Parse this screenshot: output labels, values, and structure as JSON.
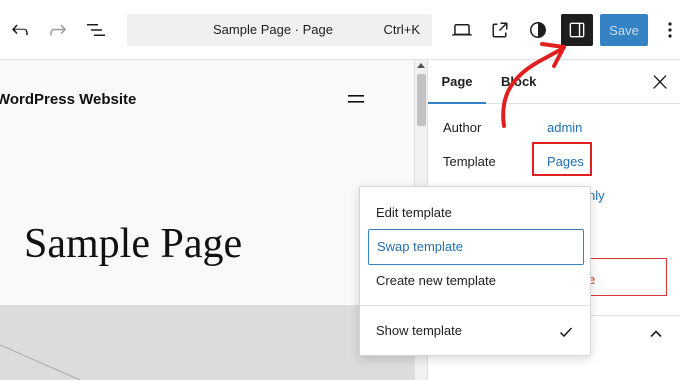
{
  "toolbar": {
    "undo_icon": "undo-icon",
    "redo_icon": "redo-icon",
    "list_view_icon": "list-view-icon",
    "document": {
      "title": "Sample Page · Page",
      "shortcut": "Ctrl+K"
    },
    "preview_icon": "desktop-preview-icon",
    "view_page_icon": "external-link-icon",
    "styles_icon": "contrast-icon",
    "settings_icon": "sidebar-panel-icon",
    "save_label": "Save",
    "more_icon": "vertical-ellipsis-icon"
  },
  "canvas": {
    "site_title": "WordPress Website",
    "page_heading": "Sample Page",
    "nav_icon": "hamburger-menu-icon"
  },
  "sidebar": {
    "tabs": [
      {
        "label": "Page",
        "active": true
      },
      {
        "label": "Block",
        "active": false
      }
    ],
    "close_icon": "close-icon",
    "rows": [
      {
        "label": "Author",
        "value": "admin"
      },
      {
        "label": "Template",
        "value": "Pages"
      }
    ],
    "partial_link": "nly",
    "partial_red_text": "e",
    "chevron_icon": "chevron-up-icon"
  },
  "template_menu": {
    "items": [
      {
        "label": "Edit template",
        "focused": false
      },
      {
        "label": "Swap template",
        "focused": true
      },
      {
        "label": "Create new template",
        "focused": false
      }
    ],
    "toggle": {
      "label": "Show template",
      "checked": true,
      "icon": "checkmark-icon"
    }
  },
  "colors": {
    "accent": "#3582c4",
    "link": "#2271b1",
    "annotation": "#e02020",
    "toolbar_active_bg": "#1e1e1e"
  }
}
